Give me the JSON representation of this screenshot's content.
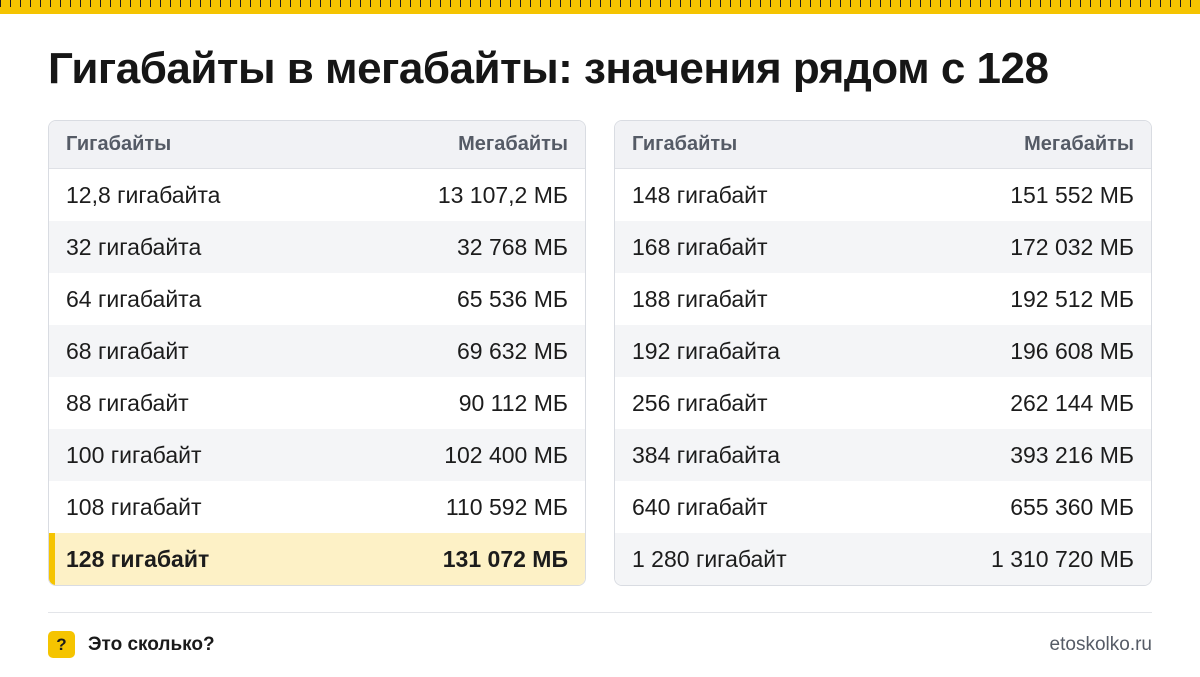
{
  "title": "Гигабайты в мегабайты: значения рядом с 128",
  "left_table": {
    "headers": [
      "Гигабайты",
      "Мегабайты"
    ],
    "rows": [
      {
        "gb": "12,8 гигабайта",
        "mb": "13 107,2 МБ"
      },
      {
        "gb": "32 гигабайта",
        "mb": "32 768 МБ"
      },
      {
        "gb": "64 гигабайта",
        "mb": "65 536 МБ"
      },
      {
        "gb": "68 гигабайт",
        "mb": "69 632 МБ"
      },
      {
        "gb": "88 гигабайт",
        "mb": "90 112 МБ"
      },
      {
        "gb": "100 гигабайт",
        "mb": "102 400 МБ"
      },
      {
        "gb": "108 гигабайт",
        "mb": "110 592 МБ"
      },
      {
        "gb": "128 гигабайт",
        "mb": "131 072 МБ",
        "highlighted": true
      }
    ]
  },
  "right_table": {
    "headers": [
      "Гигабайты",
      "Мегабайты"
    ],
    "rows": [
      {
        "gb": "148 гигабайт",
        "mb": "151 552 МБ"
      },
      {
        "gb": "168 гигабайт",
        "mb": "172 032 МБ"
      },
      {
        "gb": "188 гигабайт",
        "mb": "192 512 МБ"
      },
      {
        "gb": "192 гигабайта",
        "mb": "196 608 МБ"
      },
      {
        "gb": "256 гигабайт",
        "mb": "262 144 МБ"
      },
      {
        "gb": "384 гигабайта",
        "mb": "393 216 МБ"
      },
      {
        "gb": "640 гигабайт",
        "mb": "655 360 МБ"
      },
      {
        "gb": "1 280 гигабайт",
        "mb": "1 310 720 МБ"
      }
    ]
  },
  "footer": {
    "badge": "?",
    "brand": "Это сколько?",
    "site": "etoskolko.ru"
  },
  "colors": {
    "accent": "#f5c400",
    "highlight_row": "#fdf1c6",
    "header_bg": "#f1f2f5",
    "zebra": "#f4f5f7"
  }
}
